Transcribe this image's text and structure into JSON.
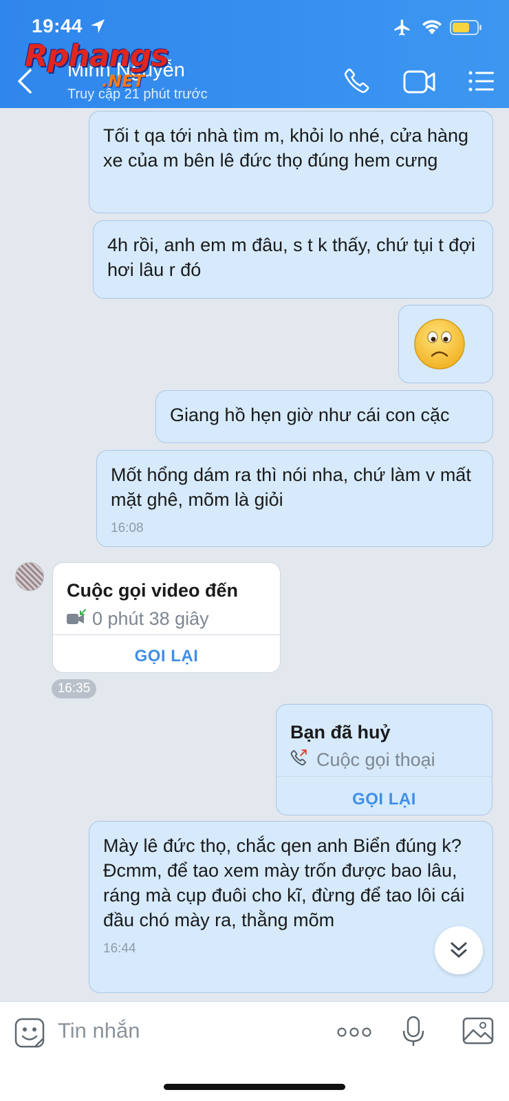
{
  "status_bar": {
    "time": "19:44"
  },
  "header": {
    "contact_name": "Minh Nguyễn",
    "last_seen": "Truy cập 21 phút trước",
    "watermark_main": "Rphangs",
    "watermark_net": ".NET",
    "icons": [
      "back-icon",
      "phone-icon",
      "video-camera-icon",
      "menu-list-icon"
    ]
  },
  "messages": [
    {
      "text": "Tối t qa tới nhà tìm m, khỏi lo nhé, cửa hàng xe của m bên lê đức thọ đúng hem cưng"
    },
    {
      "text": "4h rồi, anh em m đâu, s t k thấy, chứ tụi t đợi hơi lâu r đó"
    },
    {
      "sticker": "sad-face-emoji"
    },
    {
      "text": "Giang hồ hẹn giờ như cái con cặc"
    },
    {
      "text": "Mốt hổng dám ra thì nói nha, chứ làm v mất mặt ghê, mõm là giỏi",
      "time": "16:08"
    },
    {
      "call_title": "Cuộc gọi video đến",
      "call_detail": "0 phút 38 giây",
      "action": "GỌI LẠI",
      "time": "16:35"
    },
    {
      "call_title": "Bạn đã huỷ",
      "call_detail": "Cuộc gọi thoại",
      "action": "GỌI LẠI"
    },
    {
      "text": "Mày lê đức thọ, chắc qen anh Biển đúng k? Đcmm, để tao xem mày trốn được bao lâu, ráng mà cụp đuôi cho kĩ, đừng để tao lôi cái đầu chó mày ra, thằng mõm",
      "time": "16:44"
    }
  ],
  "input_bar": {
    "placeholder": "Tin nhắn"
  },
  "colors": {
    "header": "#3d97f1",
    "bubble": "#d6eafc",
    "action": "#3f8ee8"
  }
}
